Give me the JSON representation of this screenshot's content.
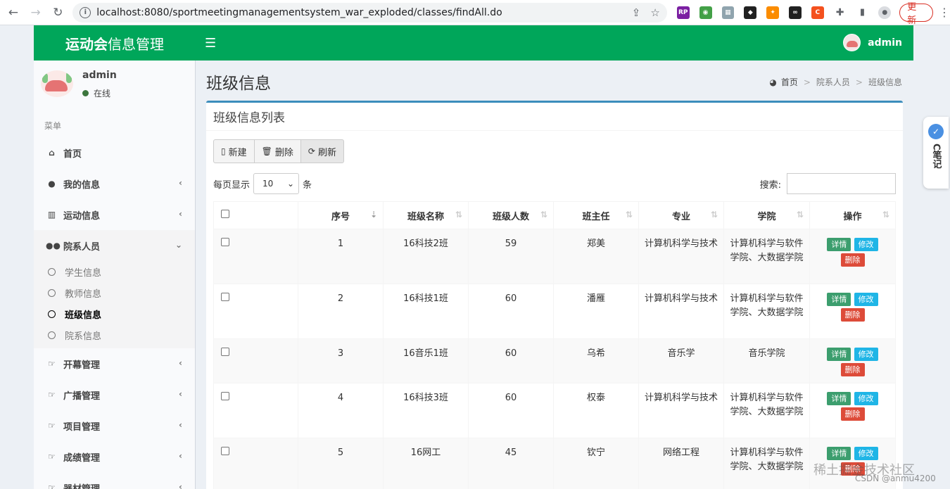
{
  "browser": {
    "url": "localhost:8080/sportmeetingmanagementsystem_war_exploded/classes/findAll.do",
    "update_label": "更新",
    "ext_labels": [
      "RP",
      "C"
    ]
  },
  "header": {
    "logo_bold": "运动会",
    "logo_rest": "信息管理",
    "user": "admin"
  },
  "sidebar": {
    "user_name": "admin",
    "status": "在线",
    "menu_header": "菜单",
    "items": [
      {
        "label": "首页",
        "icon": "home-icon",
        "caret": ""
      },
      {
        "label": "我的信息",
        "icon": "user-icon",
        "caret": "‹"
      },
      {
        "label": "运动信息",
        "icon": "bar-chart-icon",
        "caret": "‹"
      },
      {
        "label": "院系人员",
        "icon": "users-icon",
        "caret": "⌄"
      },
      {
        "label": "开幕管理",
        "icon": "hand-pointer-icon",
        "caret": "‹"
      },
      {
        "label": "广播管理",
        "icon": "hand-pointer-icon",
        "caret": "‹"
      },
      {
        "label": "项目管理",
        "icon": "hand-pointer-icon",
        "caret": "‹"
      },
      {
        "label": "成绩管理",
        "icon": "hand-pointer-icon",
        "caret": "‹"
      },
      {
        "label": "器材管理",
        "icon": "hand-pointer-icon",
        "caret": "‹"
      }
    ],
    "submenu": [
      "学生信息",
      "教师信息",
      "班级信息",
      "院系信息"
    ],
    "active_sub": "班级信息"
  },
  "content": {
    "page_title": "班级信息",
    "breadcrumb": [
      "首页",
      "院系人员",
      "班级信息"
    ],
    "box_title": "班级信息列表",
    "buttons": {
      "new": "新建",
      "delete": "删除",
      "refresh": "刷新"
    },
    "length_prefix": "每页显示",
    "length_value": "10",
    "length_suffix": "条",
    "search_label": "搜索:"
  },
  "table": {
    "headers": [
      "序号",
      "班级名称",
      "班级人数",
      "班主任",
      "专业",
      "学院",
      "操作"
    ],
    "rows": [
      {
        "no": "1",
        "name": "16科技2班",
        "count": "59",
        "teacher": "郑美",
        "major": "计算机科学与技术",
        "college": "计算机科学与软件学院、大数据学院"
      },
      {
        "no": "2",
        "name": "16科技1班",
        "count": "60",
        "teacher": "潘雁",
        "major": "计算机科学与技术",
        "college": "计算机科学与软件学院、大数据学院"
      },
      {
        "no": "3",
        "name": "16音乐1班",
        "count": "60",
        "teacher": "乌希",
        "major": "音乐学",
        "college": "音乐学院"
      },
      {
        "no": "4",
        "name": "16科技3班",
        "count": "60",
        "teacher": "权泰",
        "major": "计算机科学与技术",
        "college": "计算机科学与软件学院、大数据学院"
      },
      {
        "no": "5",
        "name": "16网工",
        "count": "45",
        "teacher": "钦宁",
        "major": "网络工程",
        "college": "计算机科学与软件学院、大数据学院"
      }
    ],
    "actions": {
      "detail": "详情",
      "edit": "修改",
      "delete": "删除"
    }
  },
  "widget": {
    "label": "C笔记"
  },
  "watermark": {
    "line1": "稀土掘金技术社区",
    "line2": "CSDN @anmu4200"
  },
  "colors": {
    "header_green": "#00a65a",
    "box_border": "#3c8dbc",
    "detail": "#3c9e6e",
    "edit": "#1fb5e6",
    "delete": "#dd4b39"
  }
}
